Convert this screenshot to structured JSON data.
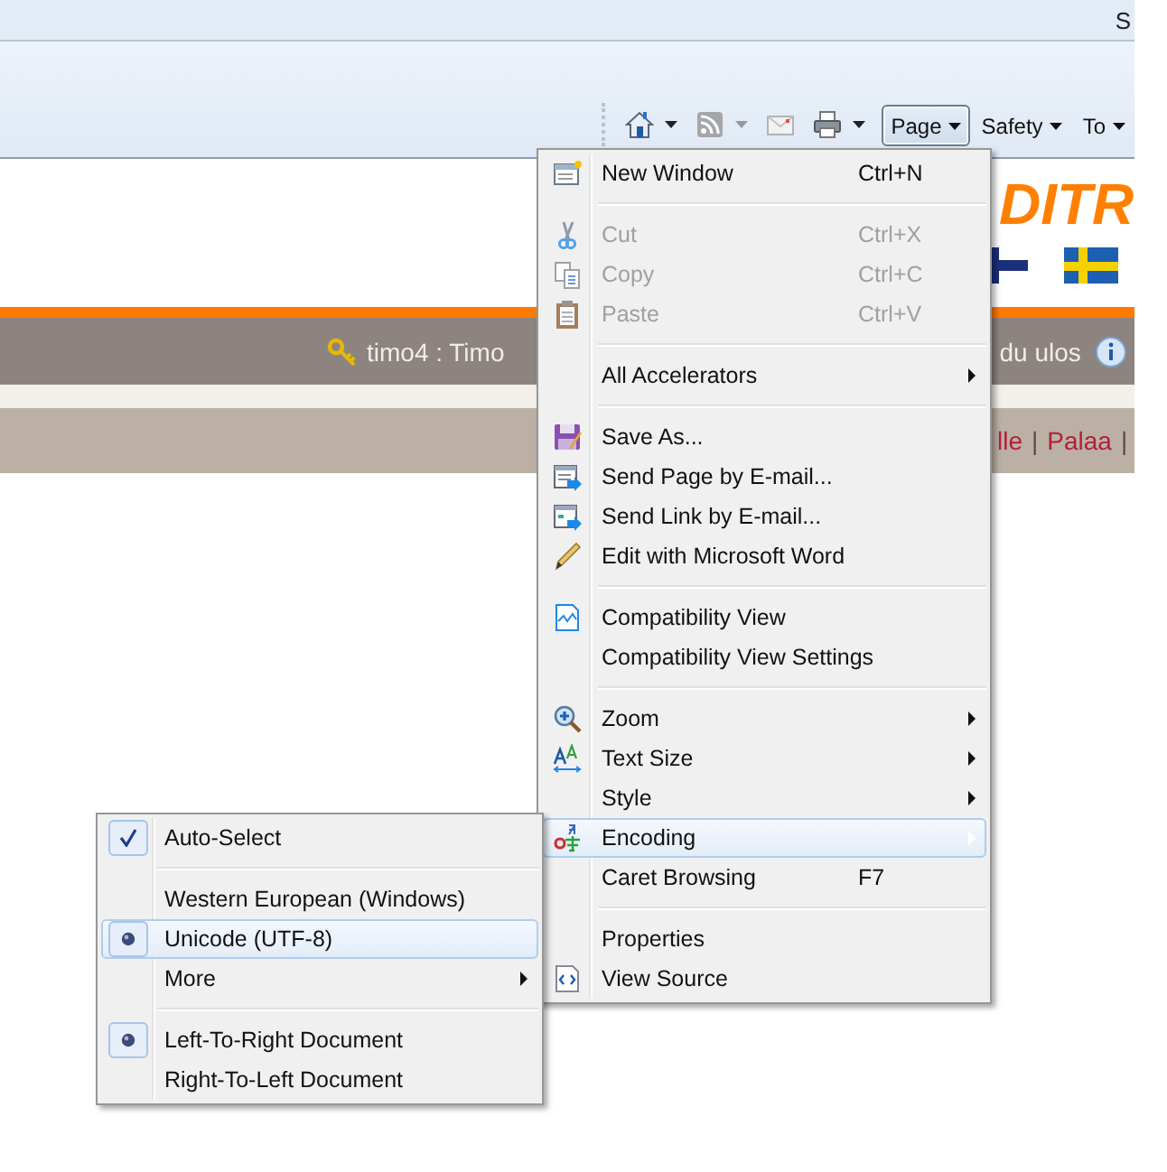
{
  "top_bar": {
    "text": "S"
  },
  "command_bar": {
    "icon_buttons": [
      {
        "kind": "home",
        "dropdown": true,
        "disabled": false
      },
      {
        "kind": "feeds",
        "dropdown": true,
        "disabled": true
      },
      {
        "kind": "mail",
        "dropdown": false,
        "disabled": true
      },
      {
        "kind": "print",
        "dropdown": true,
        "disabled": false
      }
    ],
    "menus": [
      {
        "label": "Page",
        "selected": true
      },
      {
        "label": "Safety",
        "selected": false
      },
      {
        "label": "To",
        "selected": false
      }
    ]
  },
  "page": {
    "logo_text": "DITR",
    "flags": [
      {
        "kind": "finland"
      },
      {
        "kind": "sweden"
      }
    ],
    "user": "timo4 : Timo",
    "logout": "du ulos",
    "links": [
      {
        "text": "lle",
        "kind": "link"
      },
      {
        "text": "|",
        "kind": "separator"
      },
      {
        "text": "Palaa",
        "kind": "link"
      },
      {
        "text": "|",
        "kind": "separator"
      }
    ]
  },
  "menu": {
    "sections": [
      {
        "items": [
          {
            "label": "New Window",
            "shortcut": "Ctrl+N",
            "disabled": false,
            "submenu": false,
            "selected": false
          }
        ]
      },
      {
        "items": [
          {
            "label": "Cut",
            "shortcut": "Ctrl+X",
            "disabled": true,
            "submenu": false,
            "selected": false
          },
          {
            "label": "Copy",
            "shortcut": "Ctrl+C",
            "disabled": true,
            "submenu": false,
            "selected": false
          },
          {
            "label": "Paste",
            "shortcut": "Ctrl+V",
            "disabled": true,
            "submenu": false,
            "selected": false
          }
        ]
      },
      {
        "items": [
          {
            "label": "All Accelerators",
            "disabled": false,
            "submenu": true,
            "selected": false
          }
        ]
      },
      {
        "items": [
          {
            "label": "Save As...",
            "disabled": false,
            "submenu": false,
            "selected": false
          },
          {
            "label": "Send Page by E-mail...",
            "disabled": false,
            "submenu": false,
            "selected": false
          },
          {
            "label": "Send Link by E-mail...",
            "disabled": false,
            "submenu": false,
            "selected": false
          },
          {
            "label": "Edit with Microsoft Word",
            "disabled": false,
            "submenu": false,
            "selected": false
          }
        ]
      },
      {
        "items": [
          {
            "label": "Compatibility View",
            "disabled": false,
            "submenu": false,
            "selected": false
          },
          {
            "label": "Compatibility View Settings",
            "disabled": false,
            "submenu": false,
            "selected": false
          }
        ]
      },
      {
        "items": [
          {
            "label": "Zoom",
            "disabled": false,
            "submenu": true,
            "selected": false
          },
          {
            "label": "Text Size",
            "disabled": false,
            "submenu": true,
            "selected": false
          },
          {
            "label": "Style",
            "disabled": false,
            "submenu": true,
            "selected": false
          },
          {
            "label": "Encoding",
            "disabled": false,
            "submenu": true,
            "selected": true
          },
          {
            "label": "Caret Browsing",
            "shortcut": "F7",
            "disabled": false,
            "submenu": false,
            "selected": false
          }
        ]
      },
      {
        "items": [
          {
            "label": "Properties",
            "disabled": false,
            "submenu": false,
            "selected": false
          },
          {
            "label": "View Source",
            "disabled": false,
            "submenu": false,
            "selected": false
          }
        ]
      }
    ]
  },
  "submenu": {
    "sections": [
      {
        "items": [
          {
            "label": "Auto-Select",
            "kind": "check",
            "checked": true,
            "selected": false
          }
        ]
      },
      {
        "items": [
          {
            "label": "Western European (Windows)",
            "kind": "radio",
            "checked": false,
            "selected": false
          },
          {
            "label": "Unicode (UTF-8)",
            "kind": "radio",
            "checked": true,
            "selected": true
          },
          {
            "label": "More",
            "kind": "submenu",
            "checked": false,
            "selected": false
          }
        ]
      },
      {
        "items": [
          {
            "label": "Left-To-Right Document",
            "kind": "radio",
            "checked": true,
            "selected": false
          },
          {
            "label": "Right-To-Left Document",
            "kind": "radio",
            "checked": false,
            "selected": false
          }
        ]
      }
    ]
  }
}
